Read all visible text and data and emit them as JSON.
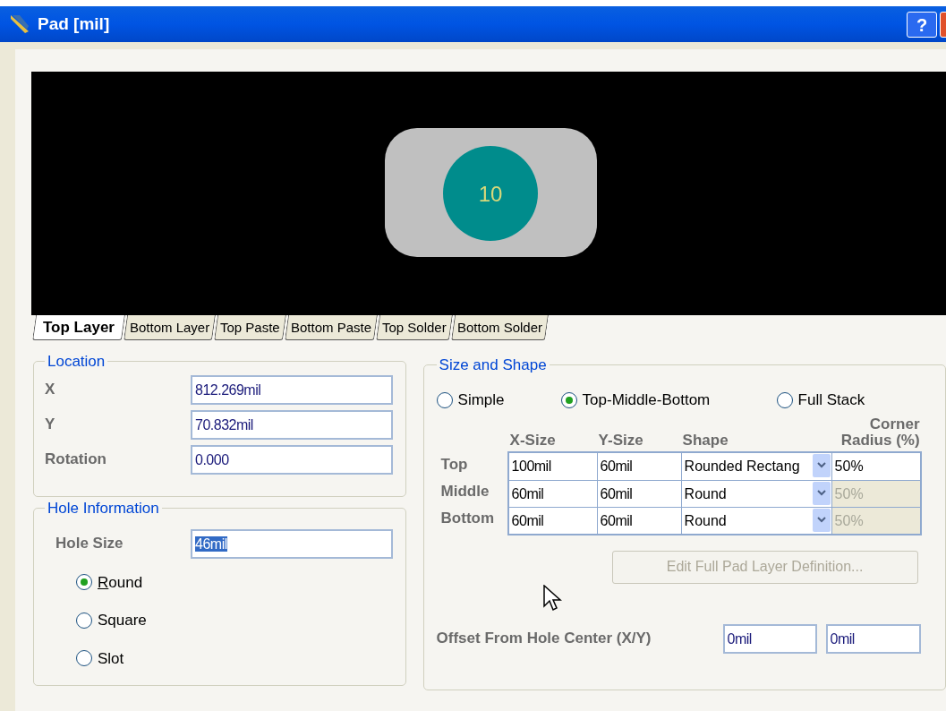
{
  "window": {
    "title": "Pad [mil]",
    "help_button": "?"
  },
  "preview": {
    "pad_number": "10"
  },
  "layer_tabs": [
    {
      "label": "Top Layer",
      "selected": true
    },
    {
      "label": "Bottom Layer",
      "selected": false
    },
    {
      "label": "Top Paste",
      "selected": false
    },
    {
      "label": "Bottom Paste",
      "selected": false
    },
    {
      "label": "Top Solder",
      "selected": false
    },
    {
      "label": "Bottom Solder",
      "selected": false
    }
  ],
  "location": {
    "title": "Location",
    "fields": [
      {
        "label": "X",
        "value": "812.269mil"
      },
      {
        "label": "Y",
        "value": "70.832mil"
      },
      {
        "label": "Rotation",
        "value": "0.000"
      }
    ]
  },
  "hole_information": {
    "title": "Hole Information",
    "hole_size": {
      "label": "Hole Size",
      "value": "46mil",
      "text_selected": true
    },
    "shapes": [
      {
        "label": "Round",
        "selected": true
      },
      {
        "label": "Square",
        "selected": false
      },
      {
        "label": "Slot",
        "selected": false
      }
    ]
  },
  "size_and_shape": {
    "title": "Size and Shape",
    "modes": [
      {
        "label": "Simple",
        "selected": false
      },
      {
        "label": "Top-Middle-Bottom",
        "selected": true
      },
      {
        "label": "Full Stack",
        "selected": false
      }
    ],
    "columns": [
      "X-Size",
      "Y-Size",
      "Shape",
      "Corner Radius (%)"
    ],
    "rows": [
      {
        "layer": "Top",
        "x_size": "100mil",
        "y_size": "60mil",
        "shape": "Rounded Rectang",
        "corner_radius": "50%",
        "corner_radius_disabled": false
      },
      {
        "layer": "Middle",
        "x_size": "60mil",
        "y_size": "60mil",
        "shape": "Round",
        "corner_radius": "50%",
        "corner_radius_disabled": true
      },
      {
        "layer": "Bottom",
        "x_size": "60mil",
        "y_size": "60mil",
        "shape": "Round",
        "corner_radius": "50%",
        "corner_radius_disabled": true
      }
    ],
    "edit_button": {
      "label": "Edit Full Pad Layer Definition...",
      "disabled": true
    },
    "offset": {
      "label": "Offset From Hole Center (X/Y)",
      "x": "0mil",
      "y": "0mil"
    }
  }
}
